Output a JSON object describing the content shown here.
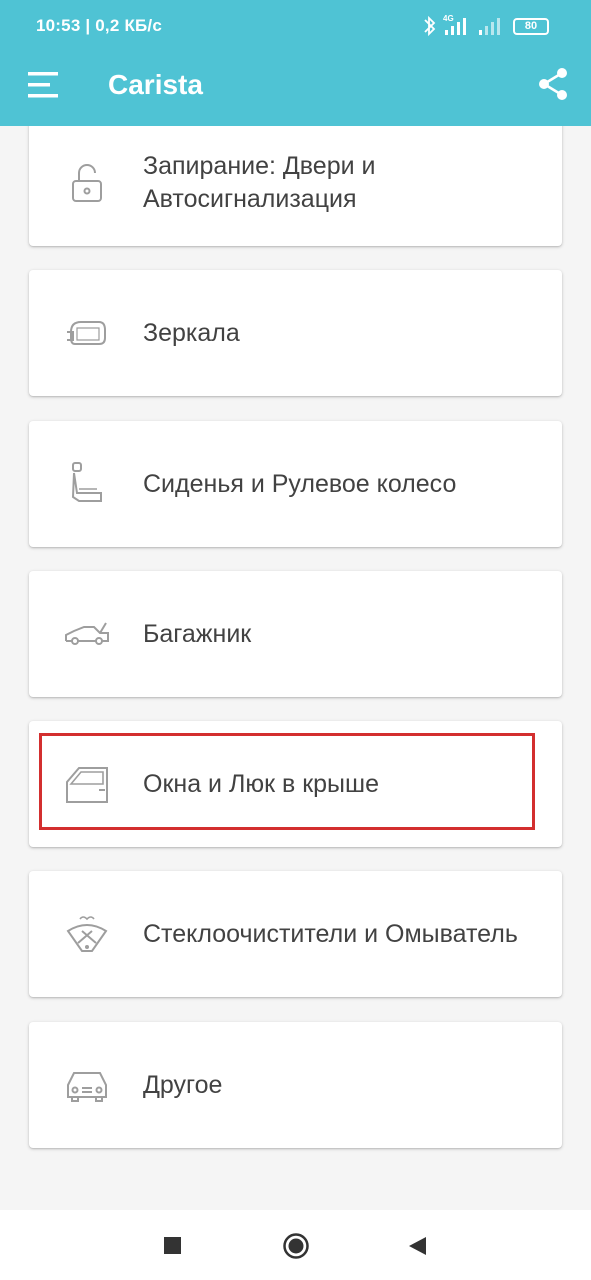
{
  "status_bar": {
    "time_speed": "10:53 | 0,2 КБ/с",
    "network": "4G",
    "battery": "80",
    "icons": [
      "bluetooth-icon",
      "signal-icon",
      "signal-icon-2",
      "battery-icon"
    ]
  },
  "toolbar": {
    "title": "Carista",
    "menu_icon": "hamburger-menu-icon",
    "share_icon": "share-icon"
  },
  "categories": [
    {
      "label": "Запирание: Двери и\nАвтосигнализация",
      "icon": "lock-icon"
    },
    {
      "label": "Зеркала",
      "icon": "mirror-icon"
    },
    {
      "label": "Сиденья и Рулевое колесо",
      "icon": "seat-icon"
    },
    {
      "label": "Багажник",
      "icon": "trunk-icon"
    },
    {
      "label": "Окна и Люк в крыше",
      "icon": "window-door-icon",
      "highlighted": true
    },
    {
      "label": "Стеклоочистители и Омыватель",
      "icon": "wiper-icon"
    },
    {
      "label": "Другое",
      "icon": "car-icon"
    }
  ],
  "nav_bar": {
    "icons": [
      "recents-square-icon",
      "home-circle-icon",
      "back-triangle-icon"
    ]
  },
  "colors": {
    "accent": "#4fc3d4",
    "highlight": "#d32f2f",
    "text": "#424242",
    "icon": "#9e9e9e"
  }
}
